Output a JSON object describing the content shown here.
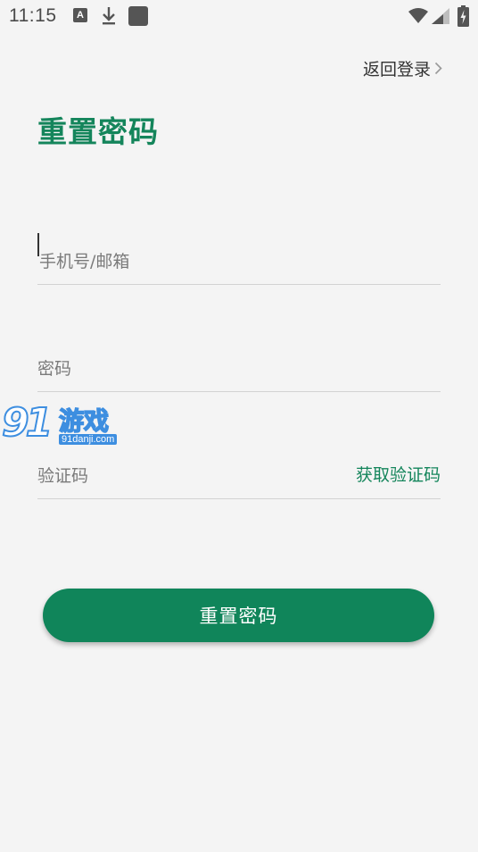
{
  "status_bar": {
    "time": "11:15",
    "notification_icon_letter": "A",
    "icons": [
      "a-notification-icon",
      "download-icon",
      "app-square-icon",
      "wifi-icon",
      "signal-icon",
      "battery-charging-icon"
    ]
  },
  "header": {
    "back_login_label": "返回登录",
    "title": "重置密码"
  },
  "form": {
    "phone_email": {
      "placeholder": "手机号/邮箱",
      "value": ""
    },
    "password": {
      "placeholder": "密码",
      "value": ""
    },
    "verification_code": {
      "placeholder": "验证码",
      "value": ""
    },
    "get_code_label": "获取验证码",
    "submit_label": "重置密码"
  },
  "watermark": {
    "logo_number": "91",
    "logo_text": "游戏",
    "domain": "91danji.com"
  },
  "colors": {
    "accent": "#10855a",
    "title_green": "#14855b",
    "background": "#f4f4f4",
    "divider": "#d2d2d2"
  }
}
